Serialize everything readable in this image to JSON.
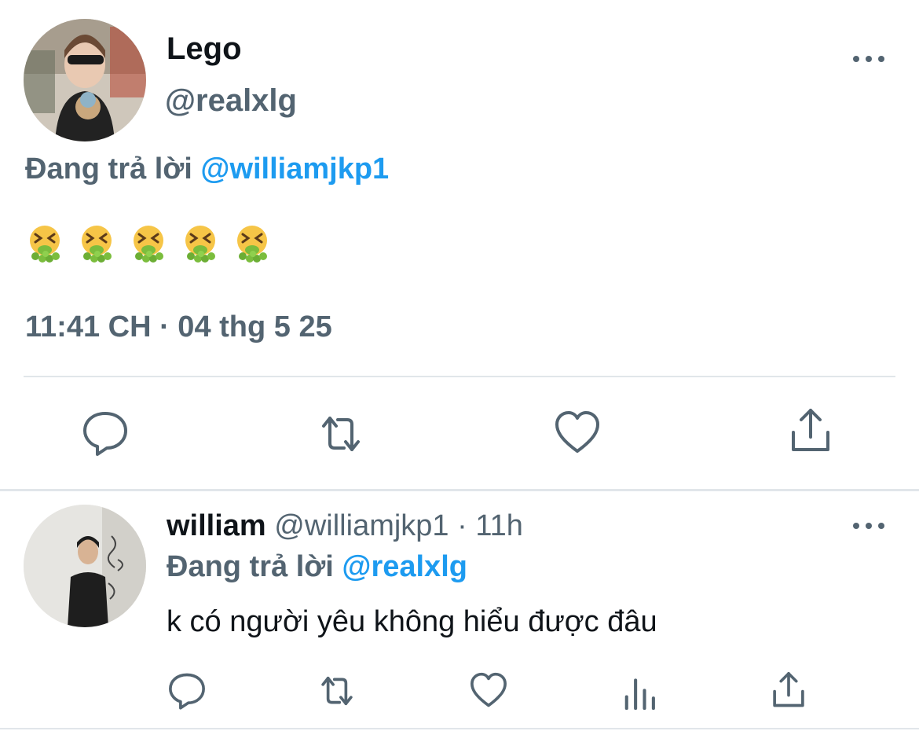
{
  "main_tweet": {
    "author_name": "Lego",
    "author_handle": "@realxlg",
    "reply_prefix": "Đang trả lời",
    "reply_to": "@williamjkp1",
    "content_emojis": [
      "vomiting-face",
      "vomiting-face",
      "vomiting-face",
      "vomiting-face",
      "vomiting-face"
    ],
    "timestamp": "11:41 CH · 04 thg 5 25"
  },
  "reply_tweet": {
    "author_name": "william",
    "author_handle": "@williamjkp1",
    "separator": "·",
    "age": "11h",
    "reply_prefix": "Đang trả lời",
    "reply_to": "@realxlg",
    "text": "k có người yêu không hiểu được đâu"
  },
  "icons": {
    "more": "more-horizontal-icon",
    "reply": "comment-icon",
    "retweet": "retweet-icon",
    "like": "heart-icon",
    "views": "analytics-icon",
    "share": "share-icon"
  },
  "colors": {
    "link_blue": "#1d9bf0",
    "secondary_text": "#536471",
    "primary_text": "#0f1419",
    "divider": "#e1e6ea"
  }
}
